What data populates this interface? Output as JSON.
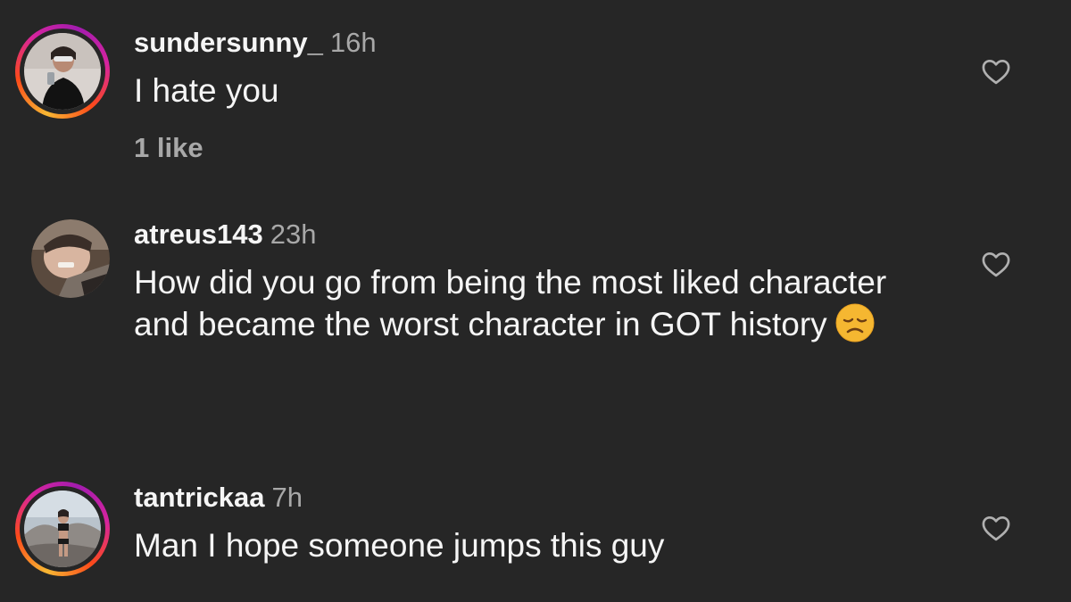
{
  "comments": [
    {
      "username": "sundersunny_",
      "time": "16h",
      "text": "I hate you",
      "likes": "1 like",
      "has_story_ring": true,
      "avatar": "woman-in-black-dress-selfie-avatar"
    },
    {
      "username": "atreus143",
      "time": "23h",
      "text": "How did you go from being the most liked character and became the worst character in GOT history",
      "emoji": "disappointed-face-emoji",
      "has_story_ring": false,
      "avatar": "person-close-up-avatar"
    },
    {
      "username": "tantrickaa",
      "time": "7h",
      "text": "Man I hope someone jumps this guy",
      "has_story_ring": true,
      "avatar": "woman-on-rocks-avatar"
    }
  ],
  "icons": {
    "like": "heart-outline-icon"
  },
  "colors": {
    "background": "#262626",
    "text": "#f5f5f5",
    "secondary": "#a8a8a8",
    "story_ring_start": "#f7b733",
    "story_ring_end": "#d6249f"
  }
}
